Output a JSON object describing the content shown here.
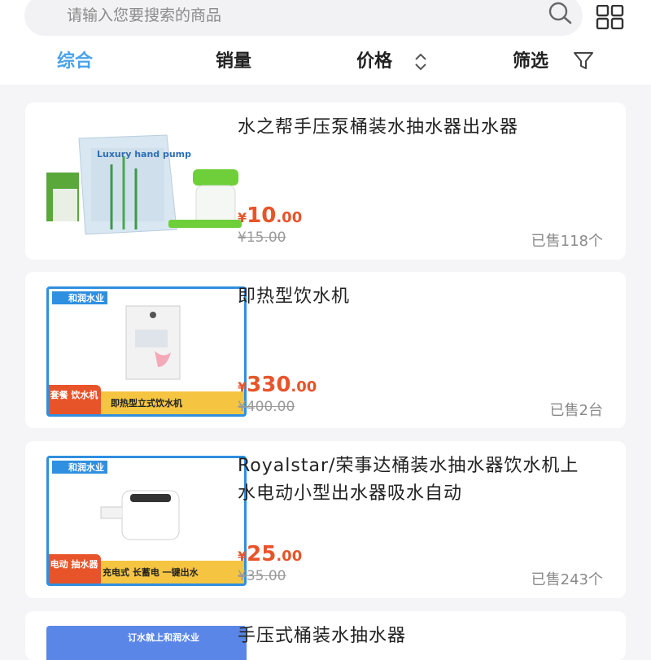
{
  "search": {
    "placeholder": "请输入您要搜索的商品"
  },
  "tabs": [
    {
      "label": "综合",
      "active": true
    },
    {
      "label": "销量"
    },
    {
      "label": "价格"
    },
    {
      "label": "筛选"
    }
  ],
  "products": [
    {
      "title": "水之帮手压泵桶装水抽水器出水器",
      "currency": "¥",
      "price_int": "10",
      "price_dec": ".00",
      "old_price": "¥15.00",
      "sold": "已售118个",
      "image_text": "Luxury hand pump"
    },
    {
      "title": "即热型饮水机",
      "currency": "¥",
      "price_int": "330",
      "price_dec": ".00",
      "old_price": "¥400.00",
      "sold": "已售2台",
      "image_brand": "和润水业",
      "image_badge": "套餐 饮水机",
      "image_caption": "即热型立式饮水机"
    },
    {
      "title": "Royalstar/荣事达桶装水抽水器饮水机上水电动小型出水器吸水自动",
      "currency": "¥",
      "price_int": "25",
      "price_dec": ".00",
      "old_price": "¥35.00",
      "sold": "已售243个",
      "image_brand": "和润水业",
      "image_badge": "电动 抽水器",
      "image_caption": "充电式 长蓄电 一键出水"
    },
    {
      "title": "手压式桶装水抽水器",
      "image_caption": "订水就上和润水业"
    }
  ],
  "colors": {
    "accent": "#4aa3ea",
    "price": "#e8542a",
    "badge": "#e8542a",
    "frame": "#2f8fe0"
  }
}
